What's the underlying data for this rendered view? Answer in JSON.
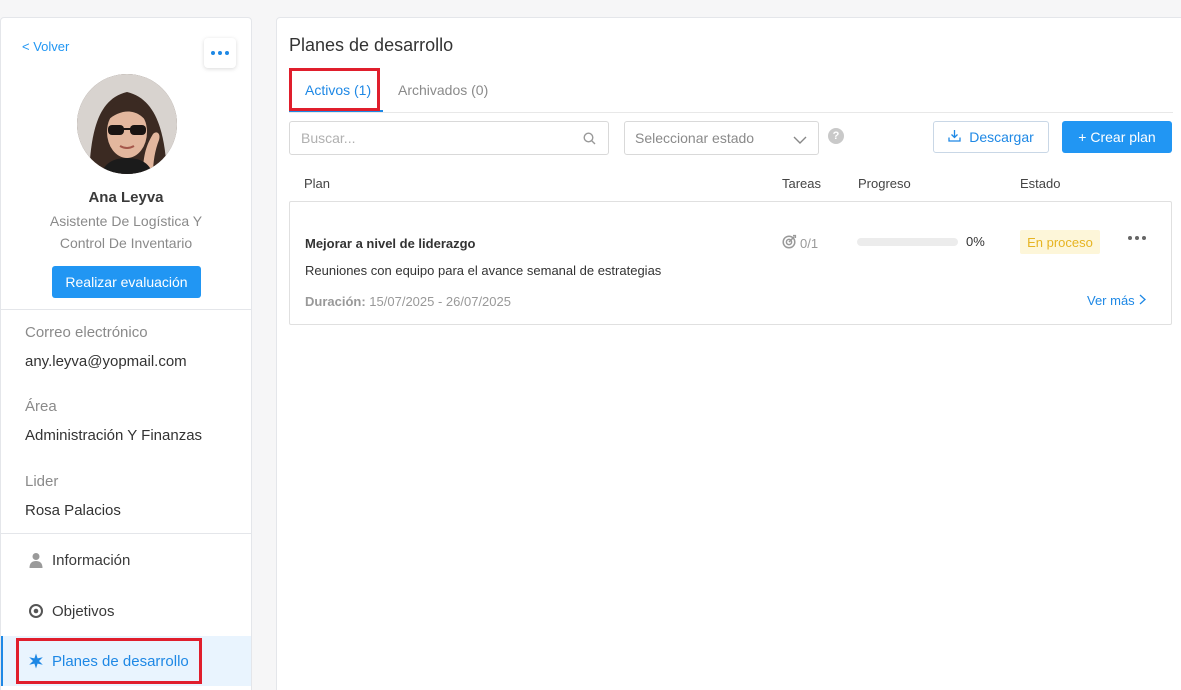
{
  "sidebar": {
    "back_label": "< Volver",
    "profile": {
      "name": "Ana Leyva",
      "role": "Asistente De Logística Y Control De Inventario",
      "evaluate_button": "Realizar evaluación"
    },
    "info": {
      "email_label": "Correo electrónico",
      "email_value": "any.leyva@yopmail.com",
      "area_label": "Área",
      "area_value": "Administración Y Finanzas",
      "leader_label": "Lider",
      "leader_value": "Rosa Palacios"
    },
    "nav": [
      {
        "label": "Información",
        "icon": "person-icon"
      },
      {
        "label": "Objetivos",
        "icon": "target-icon"
      },
      {
        "label": "Planes de desarrollo",
        "icon": "sparkle-icon",
        "active": true
      }
    ]
  },
  "main": {
    "title": "Planes de desarrollo",
    "tabs": [
      {
        "label": "Activos (1)",
        "active": true
      },
      {
        "label": "Archivados (0)",
        "active": false
      }
    ],
    "search_placeholder": "Buscar...",
    "status_select": "Seleccionar estado",
    "help": "?",
    "download_label": "Descargar",
    "create_label": "+ Crear plan",
    "columns": {
      "plan": "Plan",
      "tasks": "Tareas",
      "progress": "Progreso",
      "status": "Estado"
    },
    "plans": [
      {
        "name": "Mejorar a nivel de liderazgo",
        "description": "Reuniones con equipo para el avance semanal de estrategias",
        "duration_label": "Duración:",
        "duration_value": "15/07/2025 - 26/07/2025",
        "tasks": "0/1",
        "progress_percent": 0,
        "progress_text": "0%",
        "status": "En proceso",
        "see_more": "Ver más"
      }
    ]
  },
  "colors": {
    "accent": "#2196f3",
    "highlight": "#e01e2c",
    "status_bg": "#fdf6d9",
    "status_text": "#e6b422"
  }
}
